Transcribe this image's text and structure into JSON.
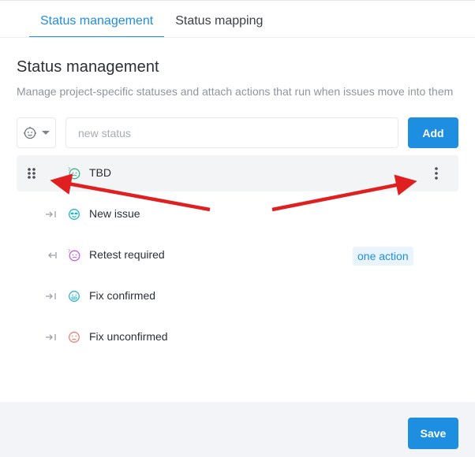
{
  "tabs": [
    {
      "label": "Status management",
      "active": true
    },
    {
      "label": "Status mapping",
      "active": false
    }
  ],
  "section": {
    "title": "Status management",
    "subtitle": "Manage project-specific statuses and attach actions that run when issues move into them"
  },
  "new_status": {
    "placeholder": "new status",
    "value": "",
    "icon": "smiley-icon",
    "add_label": "Add"
  },
  "statuses": [
    {
      "label": "TBD",
      "icon": "confused-face-icon",
      "color": "#3bb88a",
      "selected": true
    },
    {
      "label": "New issue",
      "icon": "sunglasses-face-icon",
      "color": "#1fb5c9"
    },
    {
      "label": "Retest required",
      "icon": "confused-face-icon",
      "color": "#c45fdc",
      "badge": "one action"
    },
    {
      "label": "Fix confirmed",
      "icon": "grimace-face-icon",
      "color": "#2fb6d3"
    },
    {
      "label": "Fix unconfirmed",
      "icon": "sad-face-icon",
      "color": "#ef7f6e"
    }
  ],
  "footer": {
    "save_label": "Save"
  },
  "colors": {
    "accent": "#1e8fe0",
    "annotation": "#e02020"
  }
}
